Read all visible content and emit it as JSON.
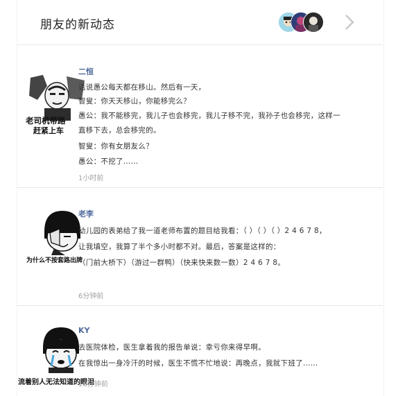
{
  "header": {
    "title": "朋友的新动态"
  },
  "icons": {
    "next": "chevron-right-icon"
  },
  "posts": [
    {
      "author": "二恒",
      "lines": [
        "话说愚公每天都在移山。然后有一天，",
        "智叟：你天天移山，你能移完么？",
        "愚公：我不能移完，我儿子也会移完，我儿子移不完，我孙子也会移完，这样一",
        "直移下去，总会移完的。",
        "智叟：你有女朋友么？",
        "愚公：不挖了……"
      ],
      "time": "1小时前",
      "meme_caption": [
        "老司机带路",
        "赶紧上车"
      ]
    },
    {
      "author": "老李",
      "lines": [
        "幼儿园的表弟给了我一道老师布置的题目给我看：（  ）（  ）（  ）2 4 6 7 8，",
        "让我填空，我算了半个多小时都不对。最后，答案是这样的：",
        "（门前大桥下）（游过一群鸭）（快来快来数一数）2 4 6 7 8。"
      ],
      "time": "6分钟前",
      "meme_caption": [
        "为什么不按套路出牌"
      ]
    },
    {
      "author": "KY",
      "lines": [
        "去医院体检，医生拿着我的报告单说：幸亏你来得早啊。",
        "在我惊出一身冷汗的时候，医生不慌不忙地说：再晚点，我就下班了……"
      ],
      "time": "18分钟前",
      "meme_caption": [
        "流着别人无法知道的眼泪"
      ]
    }
  ]
}
